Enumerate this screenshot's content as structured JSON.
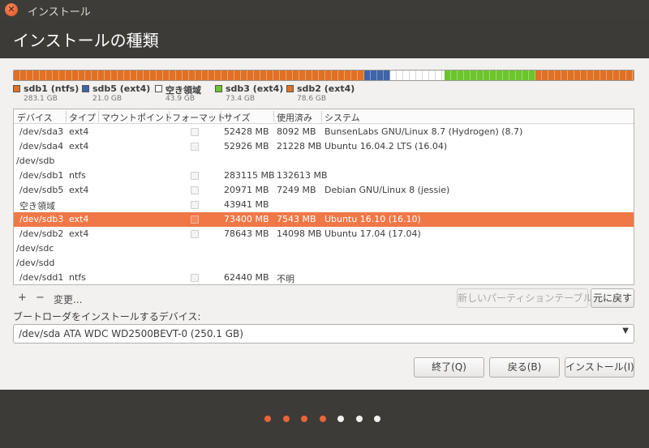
{
  "window": {
    "title": "インストール",
    "close_glyph": "✕"
  },
  "page_title": "インストールの種類",
  "partition_bar": {
    "segments": [
      {
        "name": "sdb1",
        "color": "#e07023",
        "fraction": 0.566
      },
      {
        "name": "sdb5",
        "color": "#3f64a8",
        "fraction": 0.0419
      },
      {
        "name": "free",
        "color": "#ffffff",
        "fraction": 0.0878
      },
      {
        "name": "sdb3",
        "color": "#6cc52b",
        "fraction": 0.1468
      },
      {
        "name": "sdb2",
        "color": "#e07023",
        "fraction": 0.1575
      }
    ]
  },
  "legend": [
    {
      "name": "sdb1 (ntfs)",
      "size": "283.1 GB",
      "color": "#e07023"
    },
    {
      "name": "sdb5 (ext4)",
      "size": "21.0 GB",
      "color": "#3f64a8"
    },
    {
      "name": "空き領域",
      "size": "43.9 GB",
      "color": "#ffffff"
    },
    {
      "name": "sdb3 (ext4)",
      "size": "73.4 GB",
      "color": "#6cc52b"
    },
    {
      "name": "sdb2 (ext4)",
      "size": "78.6 GB",
      "color": "#e07023"
    }
  ],
  "table": {
    "columns": [
      "デバイス",
      "タイプ",
      "マウントポイント",
      "フォーマット",
      "サイズ",
      "使用済み",
      "システム"
    ],
    "rows": [
      {
        "device": "/dev/sda3",
        "type": "ext4",
        "mount": "",
        "format": true,
        "size": "52428 MB",
        "used": "8092 MB",
        "system": "BunsenLabs GNU/Linux 8.7 (Hydrogen) (8.7)",
        "selected": false
      },
      {
        "device": "/dev/sda4",
        "type": "ext4",
        "mount": "",
        "format": true,
        "size": "52926 MB",
        "used": "21228 MB",
        "system": "Ubuntu 16.04.2 LTS (16.04)",
        "selected": false
      },
      {
        "device": "/dev/sdb",
        "type": "",
        "mount": "",
        "format": false,
        "size": "",
        "used": "",
        "system": "",
        "selected": false
      },
      {
        "device": "/dev/sdb1",
        "type": "ntfs",
        "mount": "",
        "format": true,
        "size": "283115 MB",
        "used": "132613 MB",
        "system": "",
        "selected": false
      },
      {
        "device": "/dev/sdb5",
        "type": "ext4",
        "mount": "",
        "format": true,
        "size": "20971 MB",
        "used": "7249 MB",
        "system": "Debian GNU/Linux 8 (jessie)",
        "selected": false
      },
      {
        "device": "空き領域",
        "type": "",
        "mount": "",
        "format": true,
        "size": "43941 MB",
        "used": "",
        "system": "",
        "selected": false
      },
      {
        "device": "/dev/sdb3",
        "type": "ext4",
        "mount": "",
        "format": true,
        "size": "73400 MB",
        "used": "7543 MB",
        "system": "Ubuntu 16.10 (16.10)",
        "selected": true
      },
      {
        "device": "/dev/sdb2",
        "type": "ext4",
        "mount": "",
        "format": true,
        "size": "78643 MB",
        "used": "14098 MB",
        "system": "Ubuntu 17.04 (17.04)",
        "selected": false
      },
      {
        "device": "/dev/sdc",
        "type": "",
        "mount": "",
        "format": false,
        "size": "",
        "used": "",
        "system": "",
        "selected": false
      },
      {
        "device": "/dev/sdd",
        "type": "",
        "mount": "",
        "format": false,
        "size": "",
        "used": "",
        "system": "",
        "selected": false
      },
      {
        "device": "/dev/sdd1",
        "type": "ntfs",
        "mount": "",
        "format": true,
        "size": "62440 MB",
        "used": "不明",
        "system": "",
        "selected": false
      }
    ]
  },
  "toolbar": {
    "add": "+",
    "remove": "−",
    "change": "変更...",
    "new_table": "新しいパーティションテーブル...",
    "revert": "元に戻す"
  },
  "bootloader": {
    "label": "ブートローダをインストールするデバイス:",
    "value": "/dev/sda   ATA WDC WD2500BEVT-0 (250.1 GB)",
    "arrow": "▼"
  },
  "buttons": {
    "quit": "終了(Q)",
    "back": "戻る(B)",
    "install": "インストール(I)"
  },
  "progress_dots": [
    "#e8653a",
    "#e8653a",
    "#e8653a",
    "#e8653a",
    "#f2f1f0",
    "#f2f1f0",
    "#f2f1f0"
  ]
}
